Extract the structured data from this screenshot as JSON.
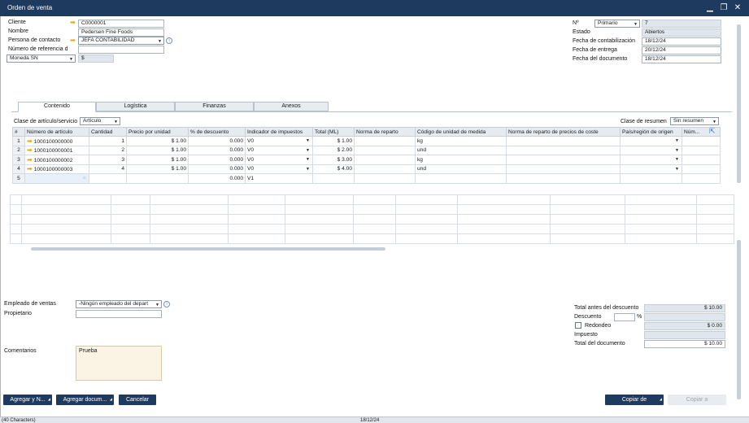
{
  "window": {
    "title": "Orden de venta"
  },
  "header_left": {
    "cliente_label": "Cliente",
    "cliente_value": "C0000001",
    "nombre_label": "Nombre",
    "nombre_value": "Pedersen Fine Foods",
    "contacto_label": "Persona de contacto",
    "contacto_value": "JEFA CONTABILIDAD",
    "referencia_label": "Número de referencia d",
    "referencia_value": "",
    "moneda_value": "Moneda SN",
    "moneda_symbol": "$"
  },
  "header_right": {
    "no_label": "Nº",
    "serie_value": "Primario",
    "no_value": "7",
    "estado_label": "Estado",
    "estado_value": "Abiertos",
    "fecha_contab_label": "Fecha de contabilización",
    "fecha_contab_value": "18/12/24",
    "fecha_entrega_label": "Fecha de entrega",
    "fecha_entrega_value": "20/12/24",
    "fecha_doc_label": "Fecha del documento",
    "fecha_doc_value": "18/12/24"
  },
  "tabs": [
    {
      "label": "Contenido"
    },
    {
      "label": "Logística"
    },
    {
      "label": "Finanzas"
    },
    {
      "label": "Anexos"
    }
  ],
  "content": {
    "clase_articulo_label": "Clase de artículo/servicio",
    "clase_articulo_value": "Artículo",
    "clase_resumen_label": "Clase de resumen",
    "clase_resumen_value": "Sin resumen",
    "columns": [
      "#",
      "Número de artículo",
      "Cantidad",
      "Precio por unidad",
      "% de descuento",
      "Indicador de impuestos",
      "Total (ML)",
      "Norma de reparto",
      "Código de unidad de medida",
      "Norma de reparto de precios de coste",
      "País/región de origen",
      "Núm..."
    ],
    "rows": [
      {
        "n": "1",
        "item": "1000100000000",
        "qty": "1",
        "price": "$ 1.00",
        "disc": "0.000",
        "tax": "V0",
        "total": "$ 1.00",
        "uom": "kg"
      },
      {
        "n": "2",
        "item": "1000100000001",
        "qty": "2",
        "price": "$ 1.00",
        "disc": "0.000",
        "tax": "V0",
        "total": "$ 2.00",
        "uom": "und"
      },
      {
        "n": "3",
        "item": "1000100000002",
        "qty": "3",
        "price": "$ 1.00",
        "disc": "0.000",
        "tax": "V0",
        "total": "$ 3.00",
        "uom": "kg"
      },
      {
        "n": "4",
        "item": "1000100000003",
        "qty": "4",
        "price": "$ 1.00",
        "disc": "0.000",
        "tax": "V0",
        "total": "$ 4.00",
        "uom": "und"
      },
      {
        "n": "5",
        "item": "",
        "qty": "",
        "price": "",
        "disc": "0.000",
        "tax": "V1",
        "total": "",
        "uom": ""
      }
    ]
  },
  "footer_left": {
    "empleado_label": "Empleado de ventas",
    "empleado_value": "-Ningún empleado del depart",
    "propietario_label": "Propietario",
    "propietario_value": "",
    "comentarios_label": "Comentarios",
    "comentarios_value": "Prueba"
  },
  "totals": {
    "antes_descuento_label": "Total antes del descuento",
    "antes_descuento_value": "$ 10.00",
    "descuento_label": "Descuento",
    "descuento_pct_symbol": "%",
    "redondeo_label": "Redondeo",
    "redondeo_value": "$ 0.00",
    "impuesto_label": "Impuesto",
    "impuesto_value": "",
    "total_doc_label": "Total del documento",
    "total_doc_value": "$ 10.00"
  },
  "buttons": {
    "agregar_y_nuevo": "Agregar y N...",
    "agregar_documento": "Agregar docum...",
    "cancelar": "Cancelar",
    "copiar_de": "Copiar de",
    "copiar_a": "Copiar a"
  },
  "statusbar": {
    "chars": "(40 Characters)",
    "date": "18/12/24"
  },
  "colors": {
    "titlebar": "#1f3a5f",
    "arrow": "#e8a200",
    "readonly": "#dfe6ee"
  }
}
